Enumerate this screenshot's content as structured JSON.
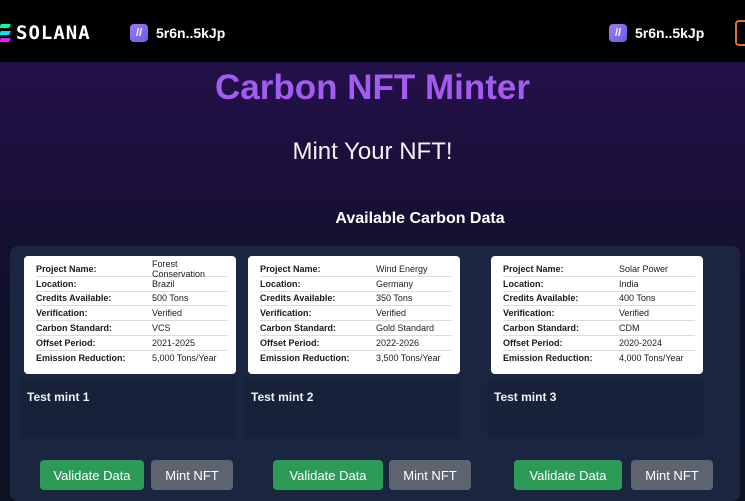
{
  "header": {
    "logo_text": "SOLANA",
    "wallet_left": "5r6n..5kJp",
    "wallet_right": "5r6n..5kJp",
    "brand_colors": [
      "#00ffa3",
      "#03e1ff",
      "#dc1fff"
    ]
  },
  "hero": {
    "title": "Carbon NFT Minter",
    "subtitle": "Mint Your NFT!",
    "section_title": "Available Carbon Data"
  },
  "field_labels": [
    "Project Name:",
    "Location:",
    "Credits Available:",
    "Verification:",
    "Carbon Standard:",
    "Offset Period:",
    "Emission Reduction:"
  ],
  "cards": [
    {
      "values": [
        "Forest Conservation",
        "Brazil",
        "500 Tons",
        "Verified",
        "VCS",
        "2021-2025",
        "5,000 Tons/Year"
      ],
      "mint_label": "Test mint 1",
      "validate_label": "Validate Data",
      "mint_button_label": "Mint NFT"
    },
    {
      "values": [
        "Wind Energy",
        "Germany",
        "350 Tons",
        "Verified",
        "Gold Standard",
        "2022-2026",
        "3,500 Tons/Year"
      ],
      "mint_label": "Test mint 2",
      "validate_label": "Validate Data",
      "mint_button_label": "Mint NFT"
    },
    {
      "values": [
        "Solar Power",
        "India",
        "400 Tons",
        "Verified",
        "CDM",
        "2020-2024",
        "4,000 Tons/Year"
      ],
      "mint_label": "Test mint 3",
      "validate_label": "Validate Data",
      "mint_button_label": "Mint NFT"
    }
  ]
}
